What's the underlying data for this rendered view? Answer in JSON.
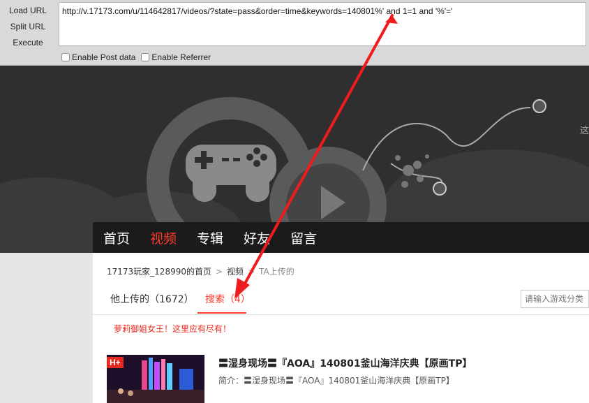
{
  "hackbar": {
    "load_url": "Load URL",
    "split_url": "Split URL",
    "execute": "Execute",
    "url_value": "http://v.17173.com/u/114642817/videos/?state=pass&order=time&keywords=140801%' and 1=1 and '%'='",
    "enable_post": "Enable Post data",
    "enable_referrer": "Enable Referrer"
  },
  "banner": {
    "side_glyph": "这"
  },
  "nav": {
    "items": [
      "首页",
      "视频",
      "专辑",
      "好友",
      "留言"
    ],
    "active_index": 1
  },
  "breadcrumb": {
    "home": "17173玩家_128990的首页",
    "sep": ">",
    "videos": "视频",
    "current": "TA上传的"
  },
  "tabs": {
    "uploaded": "他上传的（1672）",
    "search": "搜索（4）",
    "search_placeholder": "请输入游戏分类"
  },
  "promo": "萝莉御姐女王！这里应有尽有！",
  "video": {
    "badge": "H+",
    "title": "〓湿身现场〓『AOA』140801釜山海洋庆典【原画TP】",
    "desc": "简介：〓湿身现场〓『AOA』140801釜山海洋庆典【原画TP】"
  },
  "colors": {
    "accent": "#ff3a2a",
    "annotation_arrow": "#ee1c1c"
  }
}
